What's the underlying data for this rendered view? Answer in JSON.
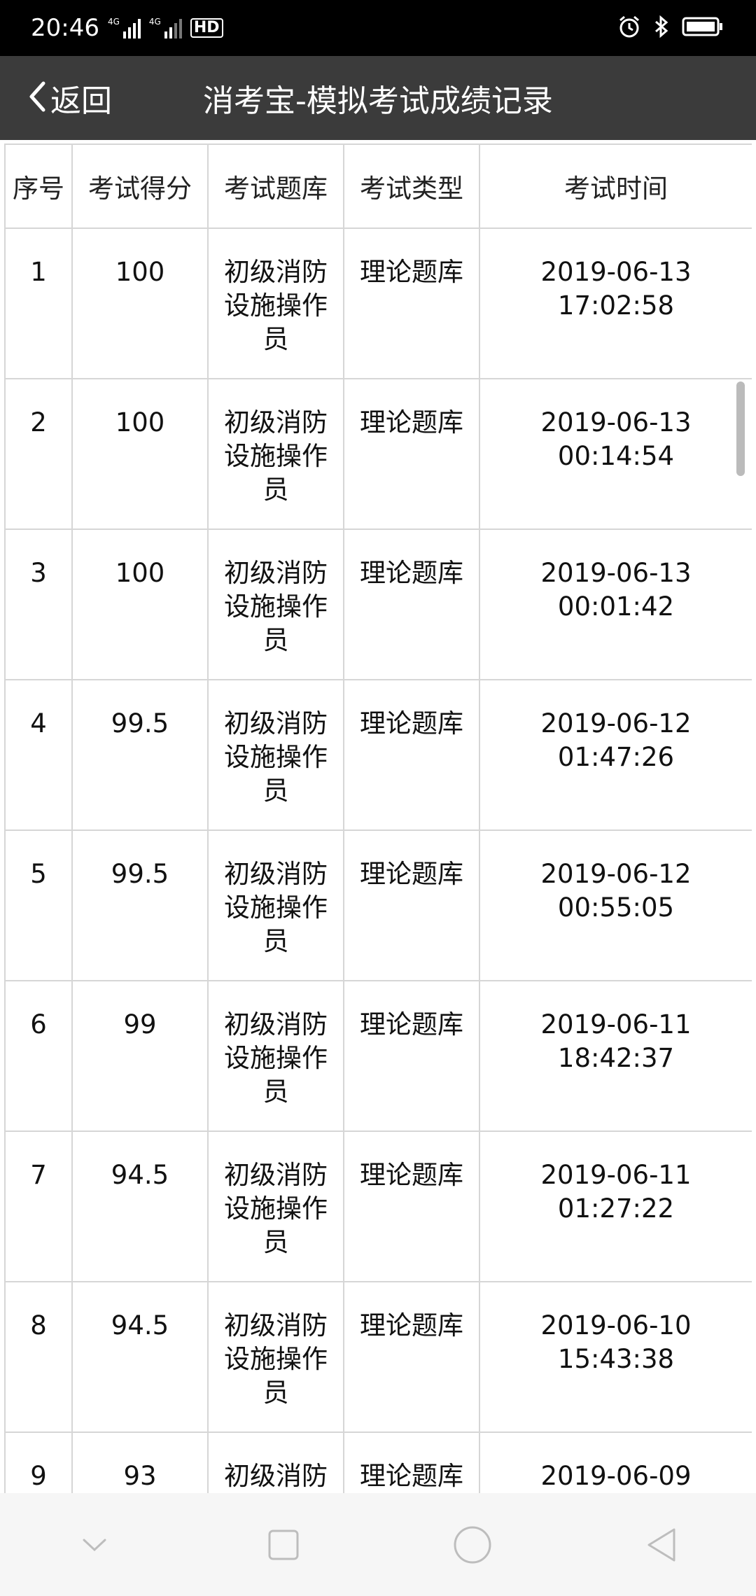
{
  "status_bar": {
    "time": "20:46",
    "sim1_label": "4G",
    "sim2_label": "4G",
    "hd_label": "HD",
    "icons": [
      "signal-icon",
      "alarm-icon",
      "bluetooth-icon",
      "battery-icon"
    ]
  },
  "header": {
    "back_label": "返回",
    "title": "消考宝-模拟考试成绩记录",
    "background": "#3b3b3b"
  },
  "table": {
    "columns": [
      "序号",
      "考试得分",
      "考试题库",
      "考试类型",
      "考试时间"
    ],
    "rows": [
      {
        "no": "1",
        "score": "100",
        "bank": "初级消防设施操作员",
        "type": "理论题库",
        "date": "2019-06-13",
        "time": "17:02:58"
      },
      {
        "no": "2",
        "score": "100",
        "bank": "初级消防设施操作员",
        "type": "理论题库",
        "date": "2019-06-13",
        "time": "00:14:54"
      },
      {
        "no": "3",
        "score": "100",
        "bank": "初级消防设施操作员",
        "type": "理论题库",
        "date": "2019-06-13",
        "time": "00:01:42"
      },
      {
        "no": "4",
        "score": "99.5",
        "bank": "初级消防设施操作员",
        "type": "理论题库",
        "date": "2019-06-12",
        "time": "01:47:26"
      },
      {
        "no": "5",
        "score": "99.5",
        "bank": "初级消防设施操作员",
        "type": "理论题库",
        "date": "2019-06-12",
        "time": "00:55:05"
      },
      {
        "no": "6",
        "score": "99",
        "bank": "初级消防设施操作员",
        "type": "理论题库",
        "date": "2019-06-11",
        "time": "18:42:37"
      },
      {
        "no": "7",
        "score": "94.5",
        "bank": "初级消防设施操作员",
        "type": "理论题库",
        "date": "2019-06-11",
        "time": "01:27:22"
      },
      {
        "no": "8",
        "score": "94.5",
        "bank": "初级消防设施操作员",
        "type": "理论题库",
        "date": "2019-06-10",
        "time": "15:43:38"
      },
      {
        "no": "9",
        "score": "93",
        "bank": "初级消防设施操作员",
        "type": "理论题库",
        "date": "2019-06-09",
        "time": ""
      }
    ]
  },
  "system_nav": {
    "buttons": [
      "chevron-down-icon",
      "square-icon",
      "circle-icon",
      "triangle-back-icon"
    ]
  }
}
